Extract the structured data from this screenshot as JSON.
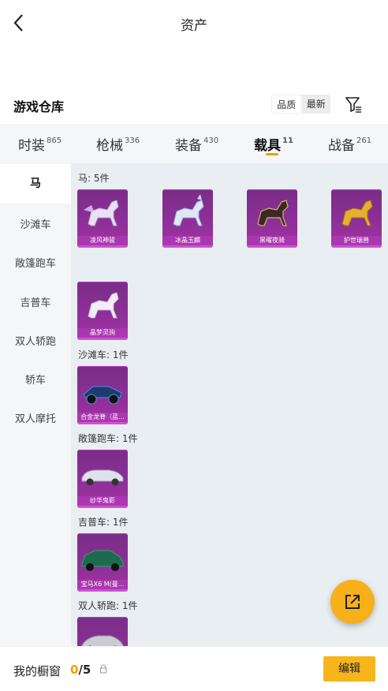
{
  "header": {
    "title": "资产"
  },
  "warehouse": {
    "title": "游戏仓库",
    "sort_options": [
      "品质",
      "最新"
    ]
  },
  "tabs": [
    {
      "label": "时装",
      "count": "865"
    },
    {
      "label": "枪械",
      "count": "336"
    },
    {
      "label": "装备",
      "count": "430"
    },
    {
      "label": "载具",
      "count": "11"
    },
    {
      "label": "战备",
      "count": "261"
    }
  ],
  "sidebar": {
    "items": [
      "马",
      "沙滩车",
      "敞篷跑车",
      "吉普车",
      "双人轿跑",
      "轿车",
      "双人摩托"
    ]
  },
  "sections": [
    {
      "label": "马: 5件",
      "items": [
        "凌风神骏",
        "冰晶玉麟",
        "黑曜夜骑",
        "护世瑞兽",
        "晶梦灵驹"
      ]
    },
    {
      "label": "沙滩车: 1件",
      "items": [
        "合金龙脊（蓝..."
      ]
    },
    {
      "label": "敞篷跑车: 1件",
      "items": [
        "纱华鬼影"
      ]
    },
    {
      "label": "吉普车: 1件",
      "items": [
        "宝马X6 M(曼..."
      ]
    },
    {
      "label": "双人轿跑: 1件",
      "items": [
        ""
      ]
    }
  ],
  "footer": {
    "label": "我的橱窗",
    "count_current": "0",
    "count_total": "/5",
    "edit_label": "编辑"
  },
  "colors": {
    "accent": "#f7b51c",
    "card": "#8d2f99",
    "sidebar_bg": "#f4f6f8"
  }
}
